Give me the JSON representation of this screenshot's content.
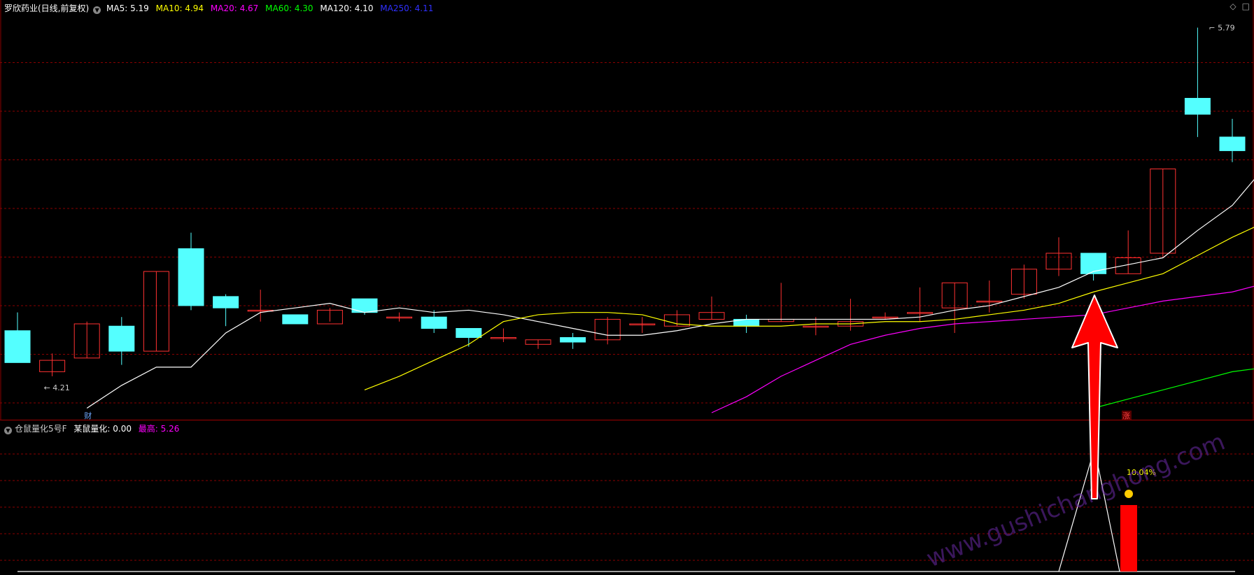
{
  "main_legend": {
    "title": "罗欣药业(日线,前复权)",
    "ma": [
      {
        "label": "MA5:",
        "value": "5.19",
        "color": "#ffffff"
      },
      {
        "label": "MA10:",
        "value": "4.94",
        "color": "#ffff00"
      },
      {
        "label": "MA20:",
        "value": "4.67",
        "color": "#ff00ff"
      },
      {
        "label": "MA60:",
        "value": "4.30",
        "color": "#00ff00"
      },
      {
        "label": "MA120:",
        "value": "4.10",
        "color": "#ffffff"
      },
      {
        "label": "MA250:",
        "value": "4.11",
        "color": "#0000ff"
      }
    ]
  },
  "sub_legend": {
    "title": "仓鼠量化5号F",
    "item1_label": "某鼠量化:",
    "item1_value": "0.00",
    "item2_label": "最高:",
    "item2_value": "5.26"
  },
  "annotations": {
    "high_price": "5.79",
    "low_price": "4.21",
    "fin_marker": "财",
    "rise_marker": "涨",
    "pct_label": "10.04%",
    "watermark": "www.gushichanghong.com"
  },
  "colors": {
    "up": "#ff3232",
    "down": "#54ffff",
    "grid": "#8a0000",
    "ma5": "#ffffff",
    "ma10": "#ffff00",
    "ma20": "#ff00ff",
    "ma60": "#00ff00",
    "arrow": "#ff0000"
  },
  "icons": {
    "corner1": "diamond-icon",
    "corner2": "square-icon"
  },
  "chart_data": {
    "type": "candlestick",
    "price_range": [
      4.1,
      5.85
    ],
    "candles": [
      {
        "o": 4.46,
        "c": 4.32,
        "h": 4.54,
        "l": 4.32
      },
      {
        "o": 4.28,
        "c": 4.33,
        "h": 4.36,
        "l": 4.26
      },
      {
        "o": 4.34,
        "c": 4.49,
        "h": 4.5,
        "l": 4.34
      },
      {
        "o": 4.48,
        "c": 4.37,
        "h": 4.52,
        "l": 4.31
      },
      {
        "o": 4.37,
        "c": 4.72,
        "h": 4.72,
        "l": 4.37
      },
      {
        "o": 4.82,
        "c": 4.57,
        "h": 4.89,
        "l": 4.55
      },
      {
        "o": 4.61,
        "c": 4.56,
        "h": 4.62,
        "l": 4.48
      },
      {
        "o": 4.55,
        "c": 4.55,
        "h": 4.64,
        "l": 4.5
      },
      {
        "o": 4.53,
        "c": 4.49,
        "h": 4.53,
        "l": 4.49
      },
      {
        "o": 4.49,
        "c": 4.55,
        "h": 4.56,
        "l": 4.5
      },
      {
        "o": 4.6,
        "c": 4.54,
        "h": 4.6,
        "l": 4.53
      },
      {
        "o": 4.52,
        "c": 4.52,
        "h": 4.54,
        "l": 4.5
      },
      {
        "o": 4.52,
        "c": 4.47,
        "h": 4.55,
        "l": 4.45
      },
      {
        "o": 4.47,
        "c": 4.43,
        "h": 4.47,
        "l": 4.39
      },
      {
        "o": 4.43,
        "c": 4.43,
        "h": 4.47,
        "l": 4.41
      },
      {
        "o": 4.4,
        "c": 4.42,
        "h": 4.42,
        "l": 4.38
      },
      {
        "o": 4.43,
        "c": 4.41,
        "h": 4.45,
        "l": 4.38
      },
      {
        "o": 4.42,
        "c": 4.51,
        "h": 4.52,
        "l": 4.4
      },
      {
        "o": 4.49,
        "c": 4.49,
        "h": 4.52,
        "l": 4.45
      },
      {
        "o": 4.48,
        "c": 4.53,
        "h": 4.55,
        "l": 4.48
      },
      {
        "o": 4.51,
        "c": 4.54,
        "h": 4.61,
        "l": 4.51
      },
      {
        "o": 4.51,
        "c": 4.48,
        "h": 4.53,
        "l": 4.45
      },
      {
        "o": 4.5,
        "c": 4.51,
        "h": 4.67,
        "l": 4.5
      },
      {
        "o": 4.48,
        "c": 4.48,
        "h": 4.52,
        "l": 4.44
      },
      {
        "o": 4.48,
        "c": 4.5,
        "h": 4.6,
        "l": 4.46
      },
      {
        "o": 4.52,
        "c": 4.52,
        "h": 4.54,
        "l": 4.51
      },
      {
        "o": 4.54,
        "c": 4.54,
        "h": 4.65,
        "l": 4.5
      },
      {
        "o": 4.56,
        "c": 4.67,
        "h": 4.67,
        "l": 4.45
      },
      {
        "o": 4.59,
        "c": 4.59,
        "h": 4.68,
        "l": 4.54
      },
      {
        "o": 4.62,
        "c": 4.73,
        "h": 4.75,
        "l": 4.6
      },
      {
        "o": 4.73,
        "c": 4.8,
        "h": 4.87,
        "l": 4.7
      },
      {
        "o": 4.8,
        "c": 4.71,
        "h": 4.8,
        "l": 4.68
      },
      {
        "o": 4.71,
        "c": 4.78,
        "h": 4.9,
        "l": 4.71
      },
      {
        "o": 4.8,
        "c": 5.17,
        "h": 5.17,
        "l": 4.78
      },
      {
        "o": 5.48,
        "c": 5.41,
        "h": 5.79,
        "l": 5.31
      },
      {
        "o": 5.31,
        "c": 5.25,
        "h": 5.39,
        "l": 5.2
      },
      {
        "o": 5.33,
        "c": 5.19,
        "h": 5.4,
        "l": 5.14
      }
    ],
    "ma5": [
      4.12,
      4.22,
      4.3,
      4.3,
      4.45,
      4.54,
      4.56,
      4.58,
      4.54,
      4.56,
      4.54,
      4.55,
      4.53,
      4.5,
      4.47,
      4.44,
      4.44,
      4.46,
      4.49,
      4.51,
      4.51,
      4.51,
      4.51,
      4.51,
      4.52,
      4.55,
      4.57,
      4.61,
      4.65,
      4.72,
      4.75,
      4.78,
      4.9,
      5.01,
      5.19
    ],
    "ma10": [
      4.2,
      4.26,
      4.33,
      4.4,
      4.5,
      4.53,
      4.54,
      4.54,
      4.53,
      4.49,
      4.48,
      4.48,
      4.48,
      4.49,
      4.49,
      4.5,
      4.5,
      4.51,
      4.53,
      4.55,
      4.58,
      4.63,
      4.67,
      4.71,
      4.79,
      4.87,
      4.94
    ],
    "ma20": [
      4.1,
      4.17,
      4.26,
      4.33,
      4.4,
      4.44,
      4.47,
      4.49,
      4.5,
      4.51,
      4.52,
      4.53,
      4.56,
      4.59,
      4.61,
      4.63,
      4.67
    ],
    "ma60": [
      4.12,
      4.16,
      4.2,
      4.24,
      4.28,
      4.3
    ]
  }
}
